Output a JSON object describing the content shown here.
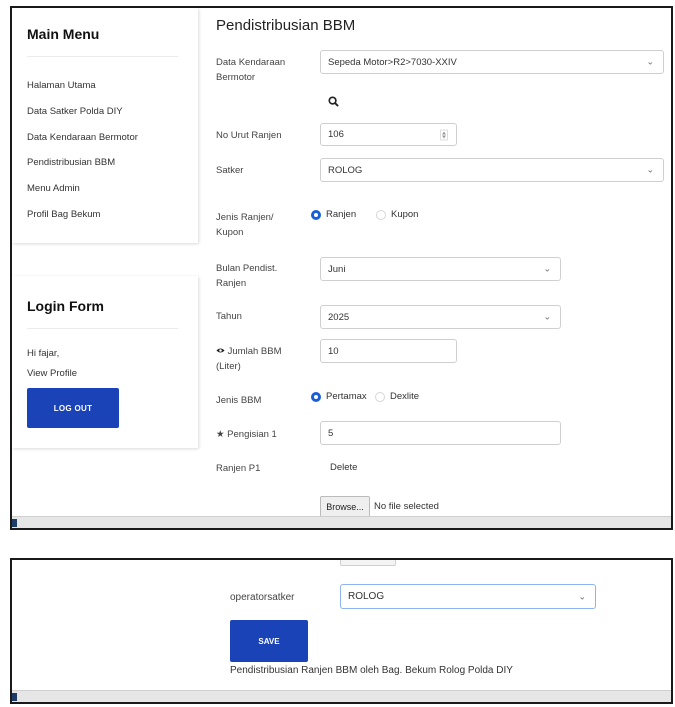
{
  "sidebar": {
    "menu_title": "Main Menu",
    "items": [
      {
        "label": "Halaman Utama"
      },
      {
        "label": "Data Satker Polda DIY"
      },
      {
        "label": "Data Kendaraan Bermotor"
      },
      {
        "label": "Pendistribusian BBM"
      },
      {
        "label": "Menu Admin"
      },
      {
        "label": "Profil Bag Bekum"
      }
    ],
    "login": {
      "title": "Login Form",
      "greeting": "Hi fajar,",
      "view_profile": "View Profile",
      "logout_label": "LOG OUT"
    }
  },
  "form": {
    "title": "Pendistribusian BBM",
    "data_kendaraan": {
      "label": "Data Kendaraan Bermotor",
      "value": "Sepeda Motor>R2>7030-XXIV"
    },
    "no_urut": {
      "label": "No Urut Ranjen",
      "value": "106"
    },
    "satker": {
      "label": "Satker",
      "value": "ROLOG"
    },
    "jenis_ranjen": {
      "label": "Jenis Ranjen/ Kupon",
      "options": [
        "Ranjen",
        "Kupon"
      ],
      "selected": "Ranjen"
    },
    "bulan": {
      "label": "Bulan Pendist. Ranjen",
      "value": "Juni"
    },
    "tahun": {
      "label": "Tahun",
      "value": "2025"
    },
    "jumlah": {
      "label": "Jumlah BBM (Liter)",
      "value": "10"
    },
    "jenis_bbm": {
      "label": "Jenis BBM",
      "options": [
        "Pertamax",
        "Dexlite"
      ],
      "selected": "Pertamax"
    },
    "pengisian": {
      "label": "Pengisian 1",
      "value": "5"
    },
    "ranjen_p1": {
      "label": "Ranjen P1",
      "delete_label": "Delete"
    },
    "file": {
      "browse_label": "Browse...",
      "status": "No file selected"
    },
    "operator": {
      "label": "operatorsatker",
      "value": "ROLOG"
    },
    "save_label": "SAVE",
    "footer_note": "Pendistribusian Ranjen BBM oleh Bag. Bekum Rolog Polda DIY"
  },
  "icons": {
    "search": "search-icon",
    "eye": "eye-icon",
    "star": "star-icon",
    "chevron": "chevron-down-icon"
  },
  "colors": {
    "primary_button": "#1a43b8",
    "radio_selected": "#1a5fd6"
  }
}
